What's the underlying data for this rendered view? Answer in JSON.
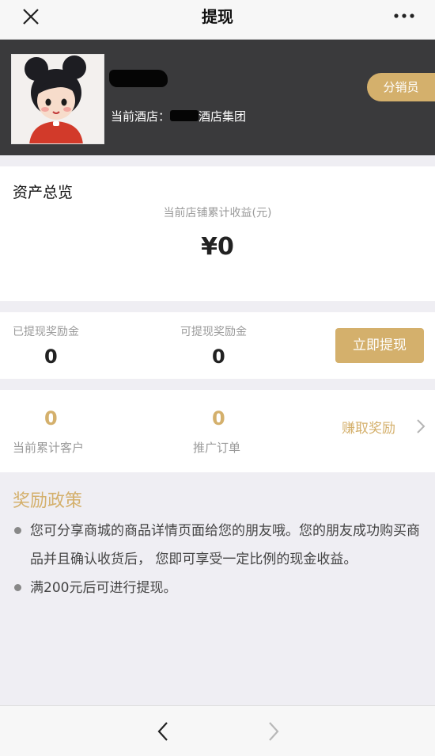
{
  "nav": {
    "title": "提现",
    "close_icon": "close-icon",
    "more_icon": "more-icon"
  },
  "profile": {
    "hotel_prefix": "当前酒店：",
    "hotel_suffix": "酒店集团",
    "role_badge": "分销员"
  },
  "assets": {
    "title": "资产总览",
    "subtitle": "当前店铺累计收益(元)",
    "amount": "¥0"
  },
  "withdraw": {
    "withdrawn_label": "已提现奖励金",
    "withdrawn_value": "0",
    "available_label": "可提现奖励金",
    "available_value": "0",
    "button_label": "立即提现"
  },
  "promo": {
    "customers_value": "0",
    "customers_label": "当前累计客户",
    "orders_value": "0",
    "orders_label": "推广订单",
    "earn_label": "赚取奖励"
  },
  "policy": {
    "title": "奖励政策",
    "items": [
      "您可分享商城的商品详情页面给您的朋友哦。您的朋友成功购买商品并且确认收货后， 您即可享受一定比例的现金收益。",
      "满200元后可进行提现。"
    ]
  },
  "bottom_nav": {
    "back_icon": "chevron-left-icon",
    "forward_icon": "chevron-right-icon"
  },
  "colors": {
    "accent_gold": "#d4b06c",
    "profile_bg": "#3a3a3c",
    "page_bg": "#efeef3"
  }
}
